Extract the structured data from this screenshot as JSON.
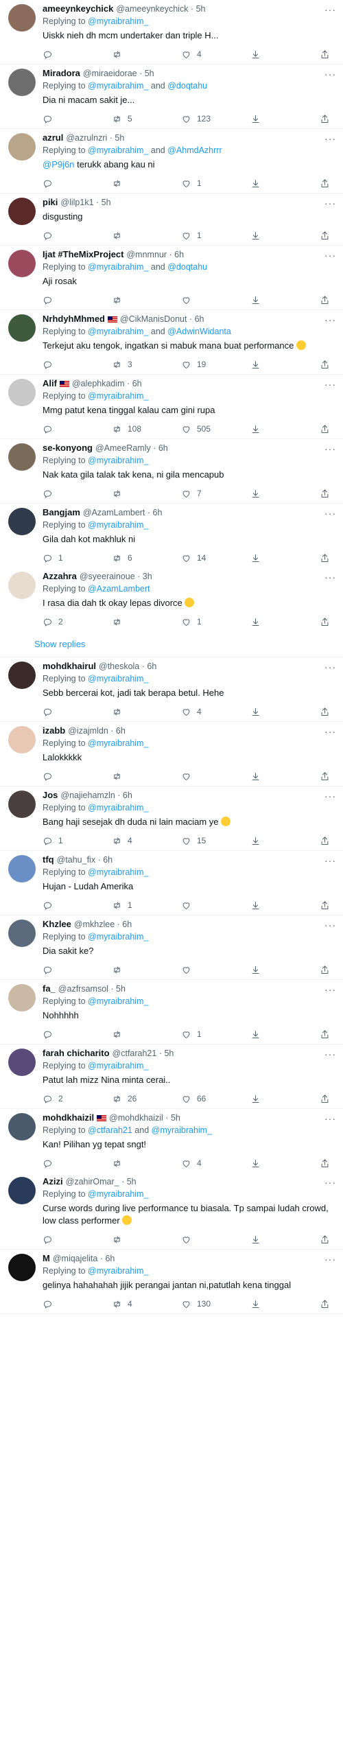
{
  "ui": {
    "replying_prefix": "Replying to ",
    "and": " and ",
    "separator": " · ",
    "more_glyph": "···",
    "show_replies": "Show replies",
    "link_color": "#1d9bf0"
  },
  "replies": [
    {
      "name": "ameeynkeychick",
      "handle": "@ameeynkeychick",
      "time": "5h",
      "to": [
        "@myraibrahim_"
      ],
      "text": "Uiskk nieh dh mcm undertaker dan triple H...",
      "counts": {
        "reply": "",
        "retweet": "",
        "like": "4"
      },
      "avatar": "#8b6b5b"
    },
    {
      "name": "Miradora",
      "handle": "@miraeidorae",
      "time": "5h",
      "to": [
        "@myraibrahim_",
        "@doqtahu"
      ],
      "text": "Dia ni macam sakit je...",
      "counts": {
        "reply": "",
        "retweet": "5",
        "like": "123"
      },
      "avatar": "#6e6e6e"
    },
    {
      "name": "azrul",
      "handle": "@azrulnzri",
      "time": "5h",
      "to": [
        "@myraibrahim_",
        "@AhmdAzhrrr"
      ],
      "mention": "@P9j6n",
      "text": "terukk abang kau ni",
      "counts": {
        "reply": "",
        "retweet": "",
        "like": "1"
      },
      "avatar": "#b9a58a"
    },
    {
      "name": "piki",
      "handle": "@lilp1k1",
      "time": "5h",
      "to": [],
      "text": "disgusting",
      "counts": {
        "reply": "",
        "retweet": "",
        "like": "1"
      },
      "avatar": "#5a2a2a"
    },
    {
      "name": "Ijat #TheMixProject",
      "handle": "@mnmnur",
      "time": "6h",
      "to": [
        "@myraibrahim_",
        "@doqtahu"
      ],
      "text": "Aji rosak",
      "counts": {
        "reply": "",
        "retweet": "",
        "like": ""
      },
      "avatar": "#9b4b5b"
    },
    {
      "name": "NrhdyhMhmed",
      "flag": true,
      "handle": "@CikManisDonut",
      "time": "6h",
      "to": [
        "@myraibrahim_",
        "@AdwinWidanta"
      ],
      "text": "Terkejut aku tengok, ingatkan si mabuk mana buat performance",
      "emoji": true,
      "counts": {
        "reply": "",
        "retweet": "3",
        "like": "19"
      },
      "avatar": "#3d5a3d"
    },
    {
      "name": "Alif",
      "flag": true,
      "handle": "@alephkadim",
      "time": "6h",
      "to": [
        "@myraibrahim_"
      ],
      "text": "Mmg patut kena tinggal kalau cam gini rupa",
      "counts": {
        "reply": "",
        "retweet": "108",
        "like": "505"
      },
      "avatar": "#c8c8c8"
    },
    {
      "name": "se-konyong",
      "handle": "@AmeeRamly",
      "time": "6h",
      "to": [
        "@myraibrahim_"
      ],
      "text": "Nak kata gila talak tak kena, ni gila mencapub",
      "counts": {
        "reply": "",
        "retweet": "",
        "like": "7"
      },
      "avatar": "#7a6a5a",
      "thread_down": true
    },
    {
      "name": "Bangjam",
      "handle": "@AzamLambert",
      "time": "6h",
      "to": [
        "@myraibrahim_"
      ],
      "text": "Gila dah kot makhluk ni",
      "counts": {
        "reply": "1",
        "retweet": "6",
        "like": "14"
      },
      "avatar": "#2f3a4a",
      "nested": true,
      "thread_up": true
    },
    {
      "name": "Azzahra",
      "handle": "@syeerainoue",
      "time": "3h",
      "to": [
        "@AzamLambert"
      ],
      "text": "I rasa dia dah tk okay lepas divorce",
      "emoji": true,
      "counts": {
        "reply": "2",
        "retweet": "",
        "like": "1"
      },
      "avatar": "#e7dccf",
      "nested": true,
      "show_replies": true
    },
    {
      "name": "mohdkhairul",
      "handle": "@theskola",
      "time": "6h",
      "to": [
        "@myraibrahim_"
      ],
      "text": "Sebb bercerai kot, jadi tak berapa betul. Hehe",
      "counts": {
        "reply": "",
        "retweet": "",
        "like": "4"
      },
      "avatar": "#3a2a2a"
    },
    {
      "name": "izabb",
      "handle": "@izajmldn",
      "time": "6h",
      "to": [
        "@myraibrahim_"
      ],
      "text": "Lalokkkkk",
      "counts": {
        "reply": "",
        "retweet": "",
        "like": ""
      },
      "avatar": "#e8c7b5"
    },
    {
      "name": "Jos",
      "handle": "@najiehamzln",
      "time": "6h",
      "to": [
        "@myraibrahim_"
      ],
      "text": "Bang haji sesejak dh duda ni lain maciam ye",
      "emoji": true,
      "counts": {
        "reply": "1",
        "retweet": "4",
        "like": "15"
      },
      "avatar": "#4a4040"
    },
    {
      "name": "tfq",
      "handle": "@tahu_fix",
      "time": "6h",
      "to": [
        "@myraibrahim_"
      ],
      "text": "Hujan - Ludah Amerika",
      "counts": {
        "reply": "",
        "retweet": "1",
        "like": ""
      },
      "avatar": "#6a8fc7"
    },
    {
      "name": "Khzlee",
      "handle": "@mkhzlee",
      "time": "6h",
      "to": [
        "@myraibrahim_"
      ],
      "text": "Dia sakit ke?",
      "counts": {
        "reply": "",
        "retweet": "",
        "like": ""
      },
      "avatar": "#5a6a7a"
    },
    {
      "name": "fa_",
      "handle": "@azfrsamsol",
      "time": "5h",
      "to": [
        "@myraibrahim_"
      ],
      "text": "Nohhhhh",
      "counts": {
        "reply": "",
        "retweet": "",
        "like": "1"
      },
      "avatar": "#c9b9a5"
    },
    {
      "name": "farah chicharito",
      "handle": "@ctfarah21",
      "time": "5h",
      "to": [
        "@myraibrahim_"
      ],
      "text": "Patut lah mizz Nina minta cerai..",
      "counts": {
        "reply": "2",
        "retweet": "26",
        "like": "66"
      },
      "avatar": "#5a4a7a",
      "thread_down": true
    },
    {
      "name": "mohdkhaizil",
      "flag": true,
      "handle": "@mohdkhaizil",
      "time": "5h",
      "to": [
        "@ctfarah21",
        "@myraibrahim_"
      ],
      "text": "Kan! Pilihan yg tepat sngt!",
      "counts": {
        "reply": "",
        "retweet": "",
        "like": "4"
      },
      "avatar": "#4a5a6a",
      "nested": true,
      "thread_up": true
    },
    {
      "name": "Azizi",
      "handle": "@zahirOmar_",
      "time": "5h",
      "to": [
        "@myraibrahim_"
      ],
      "text": "Curse words during live performance tu biasala. Tp sampai ludah crowd, low class performer",
      "emoji": true,
      "counts": {
        "reply": "",
        "retweet": "",
        "like": ""
      },
      "avatar": "#2a3a5a"
    },
    {
      "name": "M",
      "handle": "@miqajelita",
      "time": "6h",
      "to": [
        "@myraibrahim_"
      ],
      "text": "gelinya hahahahah jijik perangai jantan ni,patutlah kena tinggal",
      "counts": {
        "reply": "",
        "retweet": "4",
        "like": "130"
      },
      "avatar": "#111111"
    }
  ]
}
